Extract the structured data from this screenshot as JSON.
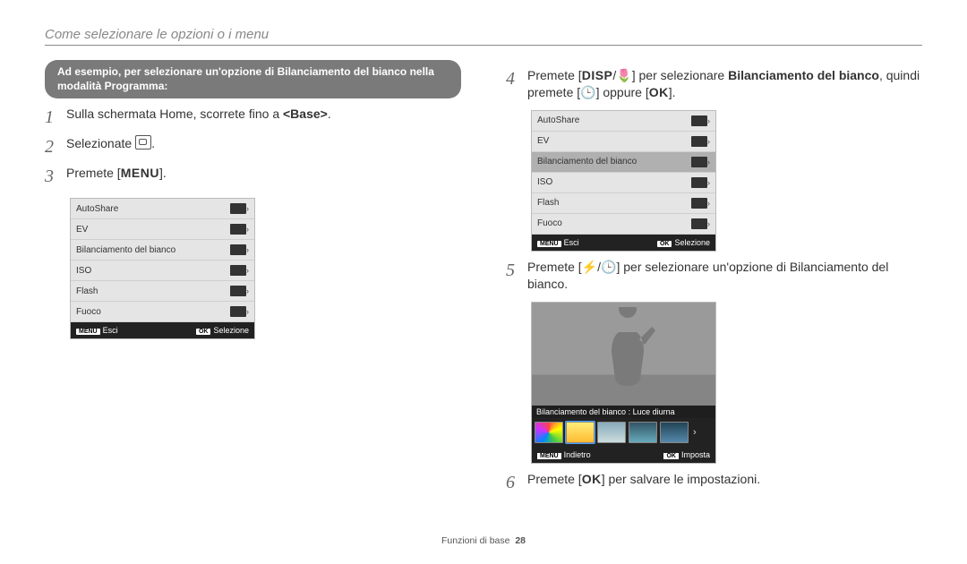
{
  "section_title": "Come selezionare le opzioni o i menu",
  "example_pill": "Ad esempio, per selezionare un'opzione di Bilanciamento del bianco nella modalità Programma:",
  "steps_left": {
    "s1_a": "Sulla schermata Home, scorrete fino a ",
    "s1_b": "<Base>",
    "s1_c": ".",
    "s2_a": "Selezionate ",
    "s2_b": ".",
    "s3_a": "Premete [",
    "s3_btn": "MENU",
    "s3_b": "]."
  },
  "steps_right": {
    "s4_a": "Premete [",
    "s4_btnA": "DISP",
    "s4_mid": "/",
    "s4_iconB": "🌷",
    "s4_b": "] per selezionare ",
    "s4_bold": "Bilanciamento del bianco",
    "s4_c": ", quindi premete [",
    "s4_iconC": "🕒",
    "s4_d": "] oppure [",
    "s4_btnOK": "OK",
    "s4_e": "].",
    "s5_a": "Premete [",
    "s5_iconA": "⚡",
    "s5_mid": "/",
    "s5_iconB": "🕒",
    "s5_b": "] per selezionare un'opzione di Bilanciamento del bianco.",
    "s6_a": "Premete [",
    "s6_btnOK": "OK",
    "s6_b": "] per salvare le impostazioni."
  },
  "menu": {
    "items": [
      {
        "label": "AutoShare"
      },
      {
        "label": "EV"
      },
      {
        "label": "Bilanciamento del bianco"
      },
      {
        "label": "ISO"
      },
      {
        "label": "Flash"
      },
      {
        "label": "Fuoco"
      }
    ],
    "footer_left_tag": "MENU",
    "footer_left": "Esci",
    "footer_right_tag": "OK",
    "footer_right": "Selezione"
  },
  "wb_preview": {
    "caption": "Bilanciamento del bianco : Luce diurna",
    "selected_index": 1,
    "footer_left_tag": "MENU",
    "footer_left": "Indietro",
    "footer_right_tag": "OK",
    "footer_right": "Imposta"
  },
  "page_footer_label": "Funzioni di base",
  "page_number": "28"
}
